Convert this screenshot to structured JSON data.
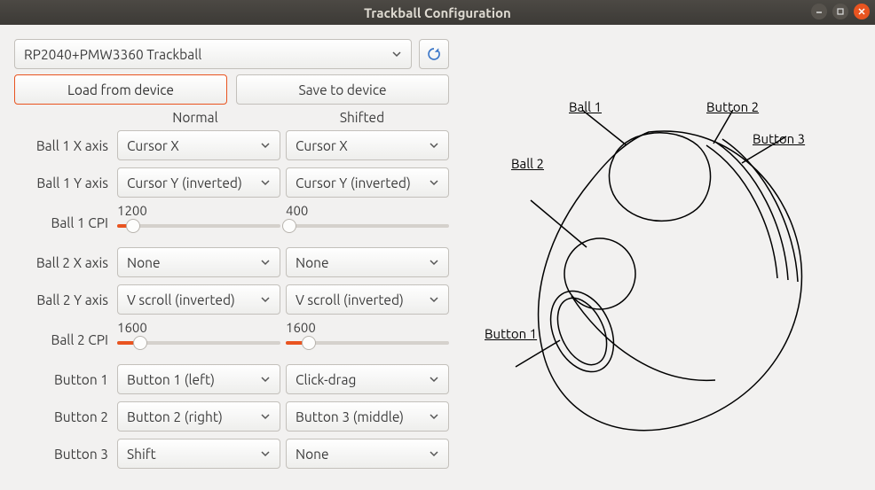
{
  "window": {
    "title": "Trackball Configuration"
  },
  "device": {
    "selected": "RP2040+PMW3360 Trackball"
  },
  "buttons": {
    "load": "Load from device",
    "save": "Save to device"
  },
  "headers": {
    "normal": "Normal",
    "shifted": "Shifted"
  },
  "rows": {
    "b1x": {
      "label": "Ball 1 X axis",
      "normal": "Cursor X",
      "shifted": "Cursor X"
    },
    "b1y": {
      "label": "Ball 1 Y axis",
      "normal": "Cursor Y (inverted)",
      "shifted": "Cursor Y (inverted)"
    },
    "b1cpi": {
      "label": "Ball 1 CPI",
      "normal": "1200",
      "shifted": "400",
      "normal_frac": 0.1,
      "shifted_frac": 0.02
    },
    "b2x": {
      "label": "Ball 2 X axis",
      "normal": "None",
      "shifted": "None"
    },
    "b2y": {
      "label": "Ball 2 Y axis",
      "normal": "V scroll (inverted)",
      "shifted": "V scroll (inverted)"
    },
    "b2cpi": {
      "label": "Ball 2 CPI",
      "normal": "1600",
      "shifted": "1600",
      "normal_frac": 0.14,
      "shifted_frac": 0.14
    },
    "btn1": {
      "label": "Button 1",
      "normal": "Button 1 (left)",
      "shifted": "Click-drag"
    },
    "btn2": {
      "label": "Button 2",
      "normal": "Button 2 (right)",
      "shifted": "Button 3 (middle)"
    },
    "btn3": {
      "label": "Button 3",
      "normal": "Shift",
      "shifted": "None"
    }
  },
  "diagram": {
    "ball1": "Ball 1",
    "ball2": "Ball 2",
    "button1": "Button 1",
    "button2": "Button 2",
    "button3": "Button 3"
  }
}
